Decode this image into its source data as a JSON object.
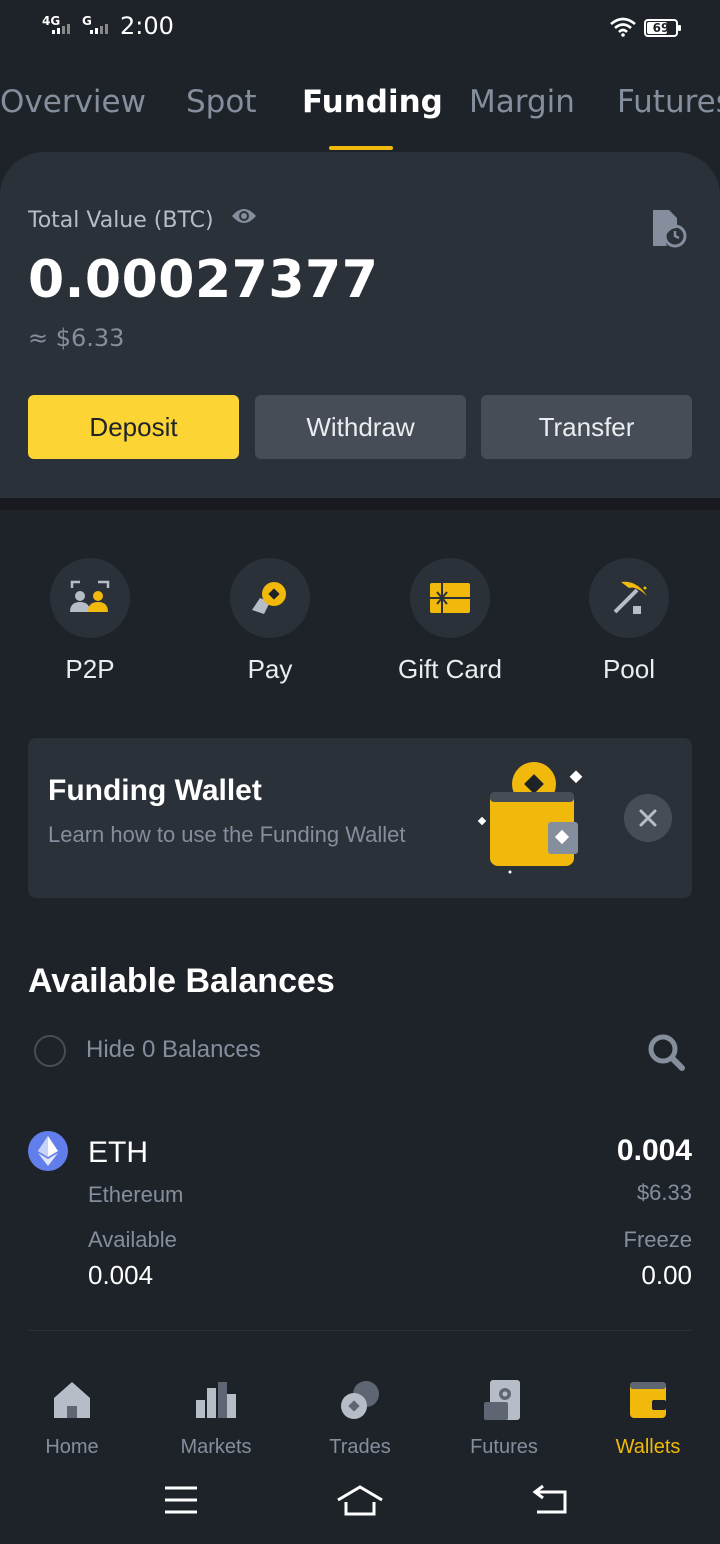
{
  "status_bar": {
    "network1": "4G",
    "network2": "G",
    "time": "2:00",
    "battery": "69"
  },
  "tabs": [
    {
      "label": "Overview"
    },
    {
      "label": "Spot"
    },
    {
      "label": "Funding",
      "active": true
    },
    {
      "label": "Margin"
    },
    {
      "label": "Futures"
    }
  ],
  "summary": {
    "total_label": "Total Value (BTC)",
    "total_value": "0.00027377",
    "total_usd": "≈ $6.33",
    "deposit_label": "Deposit",
    "withdraw_label": "Withdraw",
    "transfer_label": "Transfer"
  },
  "shortcuts": [
    {
      "label": "P2P",
      "icon": "p2p-icon"
    },
    {
      "label": "Pay",
      "icon": "pay-icon"
    },
    {
      "label": "Gift Card",
      "icon": "gift-card-icon"
    },
    {
      "label": "Pool",
      "icon": "pool-pickaxe-icon"
    }
  ],
  "banner": {
    "title": "Funding Wallet",
    "subtitle": "Learn how to use the Funding Wallet"
  },
  "balances": {
    "title": "Available Balances",
    "hide_zero_label": "Hide 0 Balances",
    "assets": [
      {
        "symbol": "ETH",
        "name": "Ethereum",
        "amount": "0.004",
        "usd": "$6.33",
        "available_label": "Available",
        "available": "0.004",
        "freeze_label": "Freeze",
        "freeze": "0.00"
      }
    ]
  },
  "bottom_nav": [
    {
      "label": "Home",
      "icon": "home-icon"
    },
    {
      "label": "Markets",
      "icon": "markets-icon"
    },
    {
      "label": "Trades",
      "icon": "trades-icon"
    },
    {
      "label": "Futures",
      "icon": "futures-icon"
    },
    {
      "label": "Wallets",
      "icon": "wallet-icon",
      "active": true
    }
  ],
  "colors": {
    "background": "#1e2329",
    "card": "#2b3139",
    "accent": "#f0b90b",
    "primary_button": "#fcd535",
    "text_muted": "#848e9c",
    "eth": "#627eea"
  }
}
